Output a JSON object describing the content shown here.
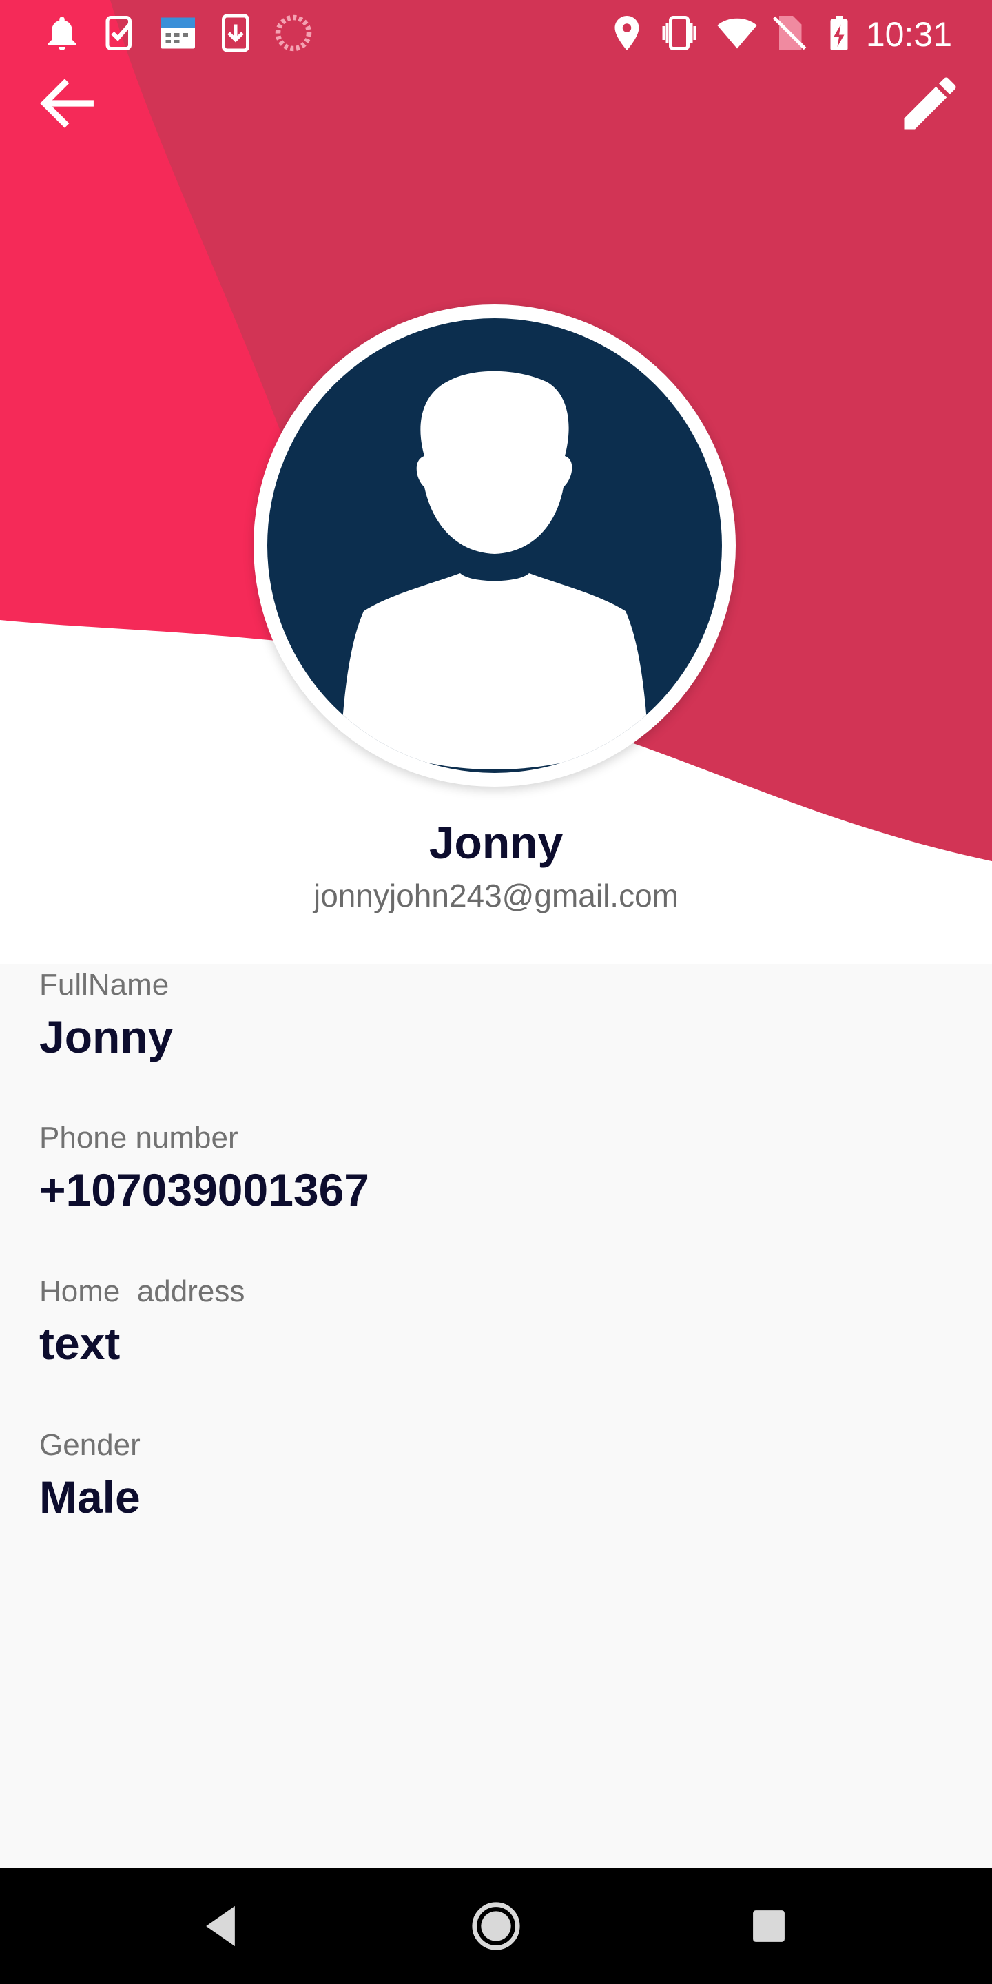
{
  "status_bar": {
    "time": "10:31",
    "left_icons": [
      "notification-bell-icon",
      "task-check-icon",
      "calendar-test-icon",
      "download-icon",
      "sync-circle-icon"
    ],
    "right_icons": [
      "location-icon",
      "vibrate-icon",
      "wifi-icon",
      "no-sim-icon",
      "battery-charging-icon"
    ]
  },
  "app_bar": {
    "back_icon": "back-arrow-icon",
    "edit_icon": "edit-pencil-icon"
  },
  "theme": {
    "accent": "#f52a58",
    "accent_dark": "#d23455",
    "avatar_bg": "#0c2e4e",
    "text_dark": "#0d0d2e",
    "text_muted": "#727272"
  },
  "profile": {
    "name": "Jonny",
    "email": "jonnyjohn243@gmail.com",
    "avatar_icon": "person-silhouette-icon"
  },
  "fields": [
    {
      "label": "FullName",
      "value": "Jonny"
    },
    {
      "label": "Phone number",
      "value": "+107039001367"
    },
    {
      "label": "Home  address",
      "value": "text"
    },
    {
      "label": "Gender",
      "value": "Male"
    }
  ],
  "nav_bar": {
    "icons": [
      "nav-back-icon",
      "nav-home-icon",
      "nav-recents-icon"
    ]
  }
}
